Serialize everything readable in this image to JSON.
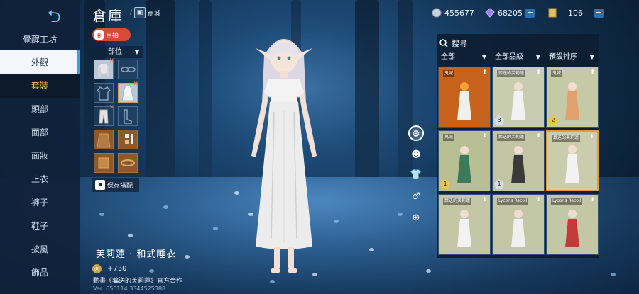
{
  "header": {
    "title": "倉庫",
    "shop_label": "商城"
  },
  "currency": [
    {
      "icon": "silver-coin-icon",
      "value": "455677"
    },
    {
      "icon": "diamond-icon",
      "value": "68205"
    },
    {
      "icon": "ticket-icon",
      "value": "106"
    }
  ],
  "sidebar": {
    "title": "覺醒工坊",
    "items": [
      "外觀",
      "套裝",
      "頭部",
      "面部",
      "面妝",
      "上衣",
      "褲子",
      "鞋子",
      "披風",
      "飾品"
    ]
  },
  "left_panel": {
    "selfie_label": "自拍",
    "part_filter": "部位",
    "save_label": "保存搭配"
  },
  "outfit": {
    "name": "芙莉蓮 · 和式睡衣",
    "points": "+730",
    "description": "動畫《葬送的芙莉蓮》官方合作",
    "version": "Ver: 650114 3344525388"
  },
  "right_panel": {
    "search_label": "搜尋",
    "filters": [
      "全部",
      "全部品級",
      "預設排序"
    ],
    "cards": [
      {
        "series": "鬼滅",
        "bg": "#c7621c",
        "rank": "",
        "rank_color": "#e8d27a"
      },
      {
        "series": "葬送的芙莉蓮",
        "bg": "#c8cdb0",
        "rank": "3",
        "rank_color": "#d9dde6"
      },
      {
        "series": "鬼滅",
        "bg": "#c6c9a6",
        "rank": "2",
        "rank_color": "#e9c84a"
      },
      {
        "series": "鬼滅",
        "bg": "#b9bf95",
        "rank": "1",
        "rank_color": "#e9c84a"
      },
      {
        "series": "葬送的芙莉蓮",
        "bg": "#c1c5a3",
        "rank": "1",
        "rank_color": "#d9dde6"
      },
      {
        "series": "葬送的芙莉蓮",
        "bg": "#cacdab",
        "rank": "",
        "rank_color": "#e9c84a"
      },
      {
        "series": "葬送的芙莉蓮",
        "bg": "#c4c7a6",
        "rank": "",
        "rank_color": "#e9c84a"
      },
      {
        "series": "Lycoris Recoil",
        "bg": "#c4c7a6",
        "rank": "",
        "rank_color": "#e9c84a"
      },
      {
        "series": "Lycoris Recoil",
        "bg": "#c4c7a6",
        "rank": "",
        "rank_color": "#e9c84a"
      }
    ]
  },
  "tools": [
    "rotate-icon",
    "hairstyle-icon",
    "shirt-icon",
    "gender-icon",
    "zoom-in-icon"
  ]
}
